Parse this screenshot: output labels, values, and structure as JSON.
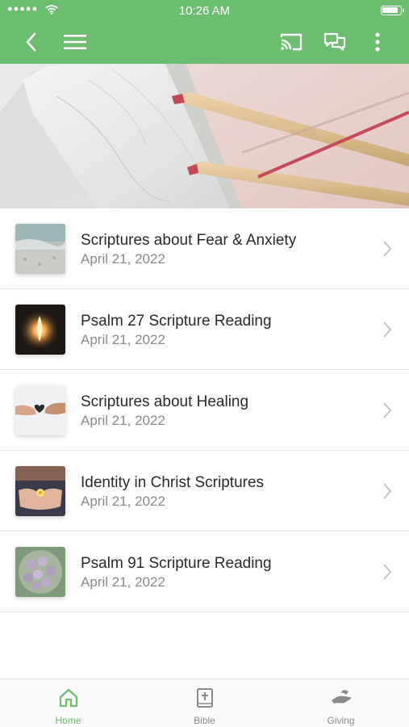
{
  "status_bar": {
    "signal": "●●●●●",
    "time": "10:26 AM"
  },
  "toolbar": {
    "back_icon": "chevron-left-icon",
    "menu_icon": "hamburger-menu-icon",
    "cast_icon": "cast-icon",
    "chat_icon": "chat-bubbles-icon",
    "more_icon": "more-vertical-icon"
  },
  "colors": {
    "brand_green": "#6cbd6e",
    "text_primary": "#2a2a2a",
    "text_secondary": "#8a8a8a",
    "tab_inactive": "#8a8a8a"
  },
  "items": [
    {
      "title": "Scriptures about Fear & Anxiety",
      "date": "April 21, 2022",
      "thumb": "beach-water"
    },
    {
      "title": "Psalm 27 Scripture Reading",
      "date": "April 21, 2022",
      "thumb": "fire-light"
    },
    {
      "title": "Scriptures about Healing",
      "date": "April 21, 2022",
      "thumb": "hands-heart"
    },
    {
      "title": "Identity in Christ Scriptures",
      "date": "April 21, 2022",
      "thumb": "hands-flower"
    },
    {
      "title": "Psalm 91 Scripture Reading",
      "date": "April 21, 2022",
      "thumb": "flowers-bowl"
    }
  ],
  "tabs": [
    {
      "label": "Home",
      "icon": "home-icon",
      "active": true
    },
    {
      "label": "Bible",
      "icon": "bible-icon",
      "active": false
    },
    {
      "label": "Giving",
      "icon": "giving-hand-icon",
      "active": false
    }
  ]
}
